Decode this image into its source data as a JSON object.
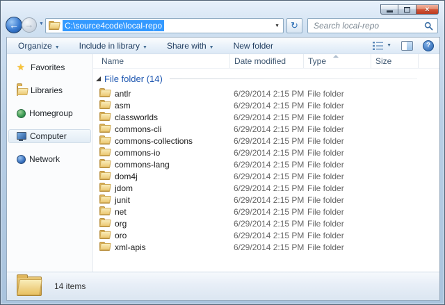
{
  "glyphs": {
    "close": "×",
    "back_arrow": "←",
    "forward_arrow": "→",
    "dropdown_arrow": "▼",
    "refresh": "↻",
    "help": "?",
    "favorites_star": "★"
  },
  "navbar": {
    "address_path": "C:\\source4code\\local-repo",
    "search_placeholder": "Search local-repo"
  },
  "toolbar": {
    "items": [
      {
        "label": "Organize",
        "has_menu": true
      },
      {
        "label": "Include in library",
        "has_menu": true
      },
      {
        "label": "Share with",
        "has_menu": true
      },
      {
        "label": "New folder",
        "has_menu": false
      }
    ]
  },
  "sidebar": {
    "items": [
      {
        "label": "Favorites",
        "icon": "star-icon",
        "selected": false
      },
      {
        "label": "Libraries",
        "icon": "library-folder-icon",
        "selected": false
      },
      {
        "label": "Homegroup",
        "icon": "homegroup-icon",
        "selected": false
      },
      {
        "label": "Computer",
        "icon": "computer-icon",
        "selected": true
      },
      {
        "label": "Network",
        "icon": "network-icon",
        "selected": false
      }
    ]
  },
  "columns": [
    {
      "label": "Name"
    },
    {
      "label": "Date modified"
    },
    {
      "label": "Type",
      "sort": "asc"
    },
    {
      "label": "Size"
    }
  ],
  "group": {
    "label": "File folder (14)"
  },
  "rows": [
    {
      "name": "antlr",
      "date_modified": "6/29/2014 2:15 PM",
      "type": "File folder",
      "size": ""
    },
    {
      "name": "asm",
      "date_modified": "6/29/2014 2:15 PM",
      "type": "File folder",
      "size": ""
    },
    {
      "name": "classworlds",
      "date_modified": "6/29/2014 2:15 PM",
      "type": "File folder",
      "size": ""
    },
    {
      "name": "commons-cli",
      "date_modified": "6/29/2014 2:15 PM",
      "type": "File folder",
      "size": ""
    },
    {
      "name": "commons-collections",
      "date_modified": "6/29/2014 2:15 PM",
      "type": "File folder",
      "size": ""
    },
    {
      "name": "commons-io",
      "date_modified": "6/29/2014 2:15 PM",
      "type": "File folder",
      "size": ""
    },
    {
      "name": "commons-lang",
      "date_modified": "6/29/2014 2:15 PM",
      "type": "File folder",
      "size": ""
    },
    {
      "name": "dom4j",
      "date_modified": "6/29/2014 2:15 PM",
      "type": "File folder",
      "size": ""
    },
    {
      "name": "jdom",
      "date_modified": "6/29/2014 2:15 PM",
      "type": "File folder",
      "size": ""
    },
    {
      "name": "junit",
      "date_modified": "6/29/2014 2:15 PM",
      "type": "File folder",
      "size": ""
    },
    {
      "name": "net",
      "date_modified": "6/29/2014 2:15 PM",
      "type": "File folder",
      "size": ""
    },
    {
      "name": "org",
      "date_modified": "6/29/2014 2:15 PM",
      "type": "File folder",
      "size": ""
    },
    {
      "name": "oro",
      "date_modified": "6/29/2014 2:15 PM",
      "type": "File folder",
      "size": ""
    },
    {
      "name": "xml-apis",
      "date_modified": "6/29/2014 2:15 PM",
      "type": "File folder",
      "size": ""
    }
  ],
  "statusbar": {
    "count_label": "14 items"
  }
}
